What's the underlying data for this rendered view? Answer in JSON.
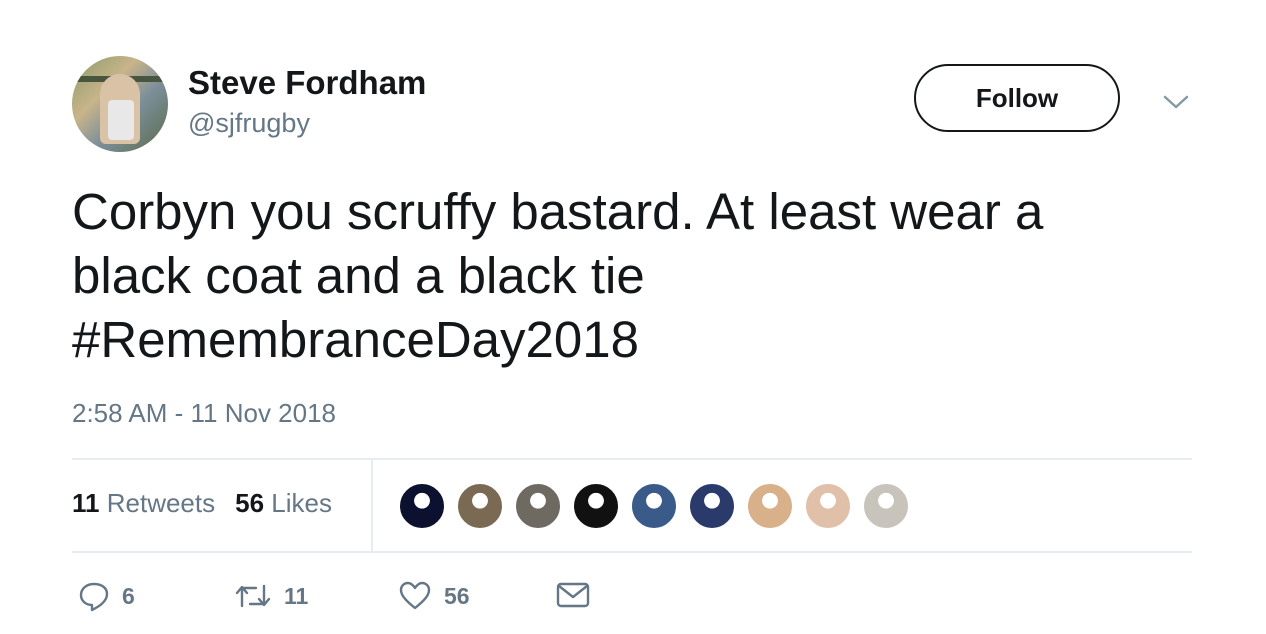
{
  "user": {
    "name": "Steve Fordham",
    "handle": "@sjfrugby"
  },
  "follow_label": "Follow",
  "tweet": {
    "text": "Corbyn you scruffy bastard. At least wear a\nblack coat and a black tie\n#RemembranceDay2018",
    "timestamp": "2:58 AM - 11 Nov 2018"
  },
  "stats": {
    "retweets_count": "11",
    "retweets_label": "Retweets",
    "likes_count": "56",
    "likes_label": "Likes"
  },
  "likers": [
    {
      "icon": "liker-avatar-1",
      "color": "#0d1130"
    },
    {
      "icon": "liker-avatar-2",
      "color": "#7a6a54"
    },
    {
      "icon": "liker-avatar-3",
      "color": "#6e6a62"
    },
    {
      "icon": "liker-avatar-4",
      "color": "#111111"
    },
    {
      "icon": "liker-avatar-5",
      "color": "#3a5a8a"
    },
    {
      "icon": "liker-avatar-6",
      "color": "#2a3a6a"
    },
    {
      "icon": "liker-avatar-7",
      "color": "#d8b08a"
    },
    {
      "icon": "liker-avatar-8",
      "color": "#e0c0a8"
    },
    {
      "icon": "liker-avatar-9",
      "color": "#c8c4bc"
    }
  ],
  "actions": {
    "replies": "6",
    "retweets": "11",
    "likes": "56"
  },
  "colors": {
    "text": "#14171a",
    "secondary": "#657786",
    "divider": "#e6ecf0"
  }
}
